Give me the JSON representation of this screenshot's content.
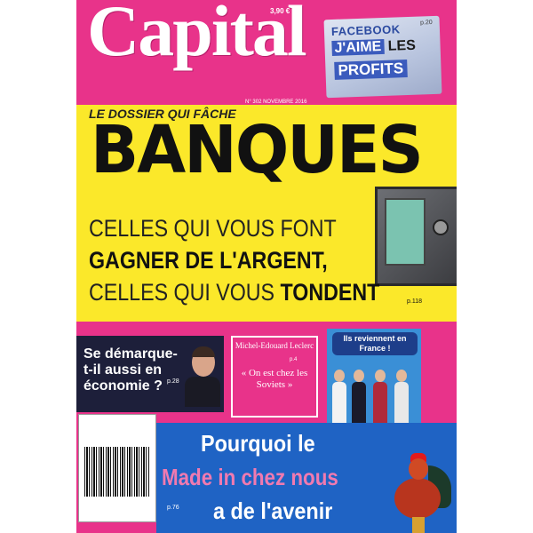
{
  "masthead": {
    "title": "Capital",
    "price": "3,90 €"
  },
  "facebook_box": {
    "brand": "FACEBOOK",
    "line2_a": "J'AIME",
    "line2_b": "LES",
    "line3": "PROFITS",
    "page": "p.20"
  },
  "issue": "N° 302 NOVEMBRE 2016",
  "main_story": {
    "kicker": "LE DOSSIER QUI FÂCHE",
    "headline": "BANQUES",
    "line1": "CELLES QUI VOUS FONT",
    "line2": "GAGNER DE L'ARGENT,",
    "line3_a": "CELLES QUI VOUS",
    "line3_b": "TONDENT",
    "page": "p.118"
  },
  "story_left": {
    "text": "Se démarque-t-il aussi en économie ?",
    "page": "p.28"
  },
  "story_middle": {
    "name": "Michel-Edouard Leclerc",
    "quote": "« On est chez les Soviets »",
    "page": "p.4"
  },
  "story_right": {
    "question": "Ils reviennent en France !"
  },
  "bottom_story": {
    "line1": "Pourquoi le",
    "line2": "Made in chez nous",
    "line3": "a de l'avenir",
    "page": "p.76"
  },
  "colors": {
    "cover_pink": "#e8338a",
    "banner_yellow": "#fbe82a",
    "bottom_blue": "#1f63c4",
    "facebook_blue": "#3b5bbd"
  }
}
